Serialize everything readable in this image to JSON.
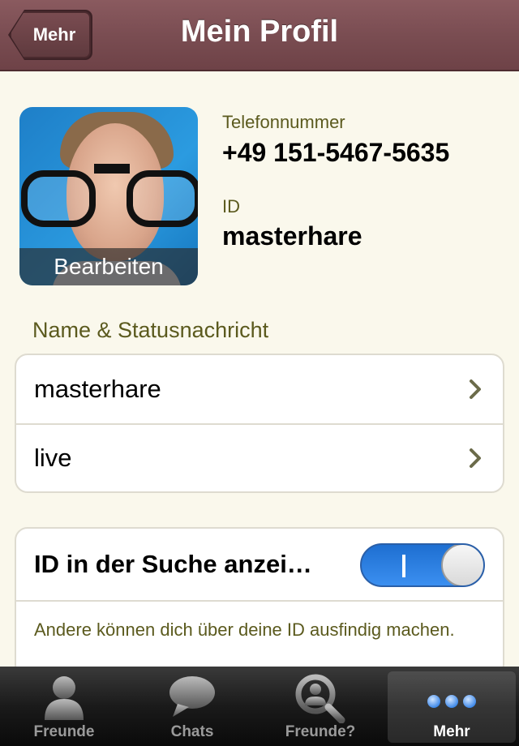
{
  "nav": {
    "back_label": "Mehr",
    "title": "Mein Profil"
  },
  "profile": {
    "avatar_edit_label": "Bearbeiten",
    "phone_label": "Telefonnummer",
    "phone_value": "+49 151-5467-5635",
    "id_label": "ID",
    "id_value": "masterhare"
  },
  "section_title": "Name & Statusnachricht",
  "rows": [
    {
      "label": "masterhare"
    },
    {
      "label": "live"
    }
  ],
  "id_search": {
    "label": "ID in der Suche anzei…",
    "toggle_on": true,
    "toggle_text": "I",
    "description": "Andere können dich über deine ID ausfindig machen."
  },
  "tabs": [
    {
      "label": "Freunde",
      "icon": "person-icon",
      "active": false
    },
    {
      "label": "Chats",
      "icon": "speech-bubble-icon",
      "active": false
    },
    {
      "label": "Freunde?",
      "icon": "magnifier-person-icon",
      "active": false
    },
    {
      "label": "Mehr",
      "icon": "more-dots-icon",
      "active": true
    }
  ],
  "colors": {
    "navbar": "#7a4d52",
    "accent_text": "#5b5a1e",
    "toggle_blue": "#2f80e6",
    "background": "#faf8ec"
  }
}
